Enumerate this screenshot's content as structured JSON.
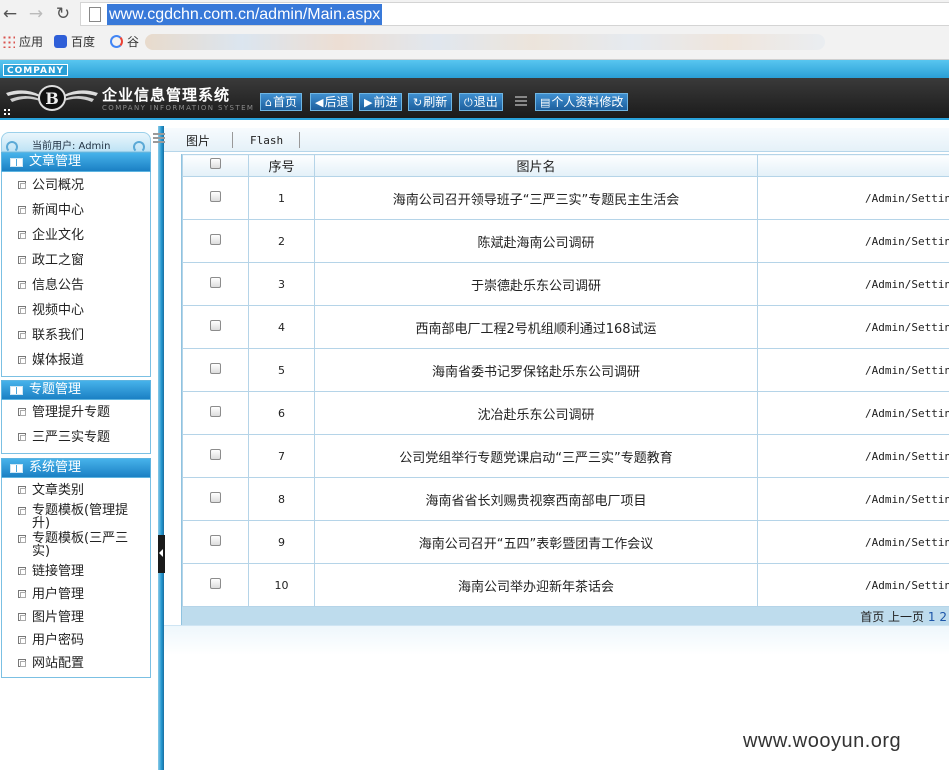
{
  "browser": {
    "url": "www.cgdchn.com.cn/admin/Main.aspx",
    "bookmarks": [
      "应用",
      "百度",
      "谷"
    ]
  },
  "header": {
    "company": "COMPANY",
    "title": "企业信息管理系统",
    "subtitle": "COMPANY INFORMATION SYSTEM",
    "buttons": [
      "首页",
      "后退",
      "前进",
      "刷新",
      "退出"
    ],
    "profile_button": "个人资料修改"
  },
  "sidebar": {
    "current_user": "当前用户: Admin",
    "sections": [
      {
        "title": "文章管理",
        "items": [
          "公司概况",
          "新闻中心",
          "企业文化",
          "政工之窗",
          "信息公告",
          "视频中心",
          "联系我们",
          "媒体报道"
        ]
      },
      {
        "title": "专题管理",
        "items": [
          "管理提升专题",
          "三严三实专题"
        ]
      },
      {
        "title": "系统管理",
        "items": [
          "文章类别",
          "专题模板(管理提升)",
          "专题模板(三严三实)",
          "链接管理",
          "用户管理",
          "图片管理",
          "用户密码",
          "网站配置"
        ]
      }
    ]
  },
  "tabs": [
    "图片",
    "Flash"
  ],
  "table": {
    "headers": [
      "",
      "序号",
      "图片名",
      ""
    ],
    "rows": [
      {
        "num": "1",
        "name": "海南公司召开领导班子“三严三实”专题民主生活会",
        "path": "/Admin/Setting"
      },
      {
        "num": "2",
        "name": "陈斌赴海南公司调研",
        "path": "/Admin/Setting"
      },
      {
        "num": "3",
        "name": "于崇德赴乐东公司调研",
        "path": "/Admin/Setting"
      },
      {
        "num": "4",
        "name": "西南部电厂工程2号机组顺利通过168试运",
        "path": "/Admin/Setting"
      },
      {
        "num": "5",
        "name": "海南省委书记罗保铭赴乐东公司调研",
        "path": "/Admin/Setting"
      },
      {
        "num": "6",
        "name": "沈冶赴乐东公司调研",
        "path": "/Admin/Setting"
      },
      {
        "num": "7",
        "name": "公司党组举行专题党课启动“三严三实”专题教育",
        "path": "/Admin/Setting"
      },
      {
        "num": "8",
        "name": "海南省省长刘赐贵视察西南部电厂项目",
        "path": "/Admin/Setting"
      },
      {
        "num": "9",
        "name": "海南公司召开“五四”表彰暨团青工作会议",
        "path": "/Admin/Setting"
      },
      {
        "num": "10",
        "name": "海南公司举办迎新年茶话会",
        "path": "/Admin/Setting"
      }
    ]
  },
  "pager": {
    "first": "首页",
    "prev": "上一页",
    "pages": [
      "1",
      "2"
    ]
  },
  "watermark": "www.wooyun.org"
}
